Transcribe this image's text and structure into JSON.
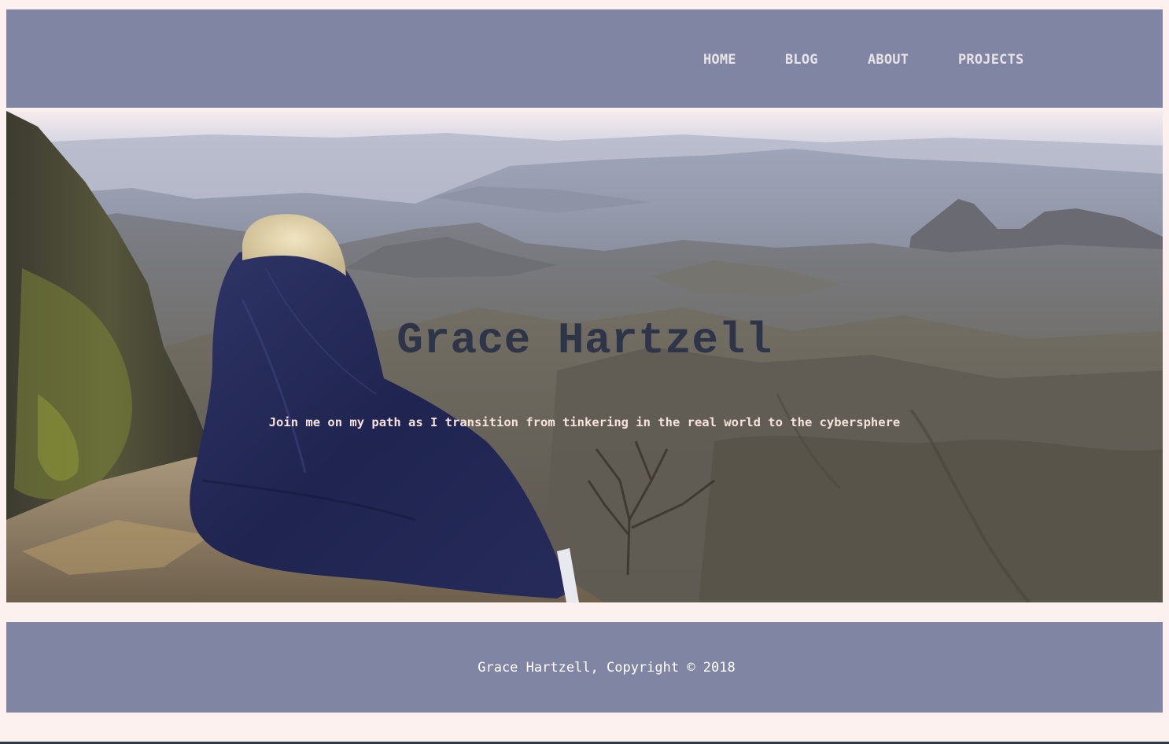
{
  "nav": {
    "home": "HOME",
    "blog": "BLOG",
    "about": "ABOUT",
    "projects": "PROJECTS"
  },
  "hero": {
    "title": "Grace Hartzell",
    "tagline": "Join me on my path as I transition from tinkering in the real world to the cybersphere"
  },
  "footer": {
    "copyright": "Grace Hartzell, Copyright © 2018"
  },
  "colors": {
    "page_background": "#fcf1ee",
    "header_footer": "#8185a4",
    "nav_text": "#e7e3e6",
    "title_text": "#2f3548",
    "tagline_text": "#f7e2dc"
  }
}
